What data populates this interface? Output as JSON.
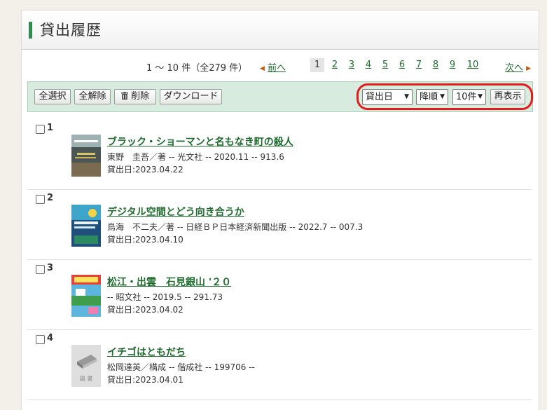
{
  "header": {
    "title": "貸出履歴"
  },
  "pager": {
    "count_text": "1 ～ 10 件（全279 件）",
    "prev_label": "前へ",
    "next_label": "次へ",
    "pages": [
      "1",
      "2",
      "3",
      "4",
      "5",
      "6",
      "7",
      "8",
      "9",
      "10"
    ],
    "current_page": "1"
  },
  "toolbar": {
    "select_all": "全選択",
    "deselect_all": "全解除",
    "delete": "削除",
    "download": "ダウンロード",
    "sort_field": "貸出日",
    "sort_order": "降順",
    "per_page": "10件",
    "redisplay": "再表示"
  },
  "items": [
    {
      "num": "1",
      "title": "ブラック・ショーマンと名もなき町の殺人",
      "meta": "東野　圭吾／著 -- 光文社 -- 2020.11 -- 913.6",
      "date": "貸出日:2023.04.22",
      "cover": "cover-image"
    },
    {
      "num": "2",
      "title": "デジタル空間とどう向き合うか",
      "meta": "鳥海　不二夫／著 -- 日経ＢＰ日本経済新聞出版 -- 2022.7 -- 007.3",
      "date": "貸出日:2023.04.10",
      "cover": "cover-image"
    },
    {
      "num": "3",
      "title": "松江・出雲　石見銀山 '２０",
      "meta": "-- 昭文社 -- 2019.5 -- 291.73",
      "date": "貸出日:2023.04.02",
      "cover": "cover-image"
    },
    {
      "num": "4",
      "title": "イチゴはともだち",
      "meta": "松岡達英／構成 -- 偕成社 -- 199706 --",
      "date": "貸出日:2023.04.01",
      "cover": "no-image",
      "no_image_label": "図 書"
    }
  ],
  "colors": {
    "accent": "#2f8a4d",
    "link": "#1f6b2e",
    "toolbar_bg": "#d7ebdf",
    "highlight": "#e21b1b"
  }
}
